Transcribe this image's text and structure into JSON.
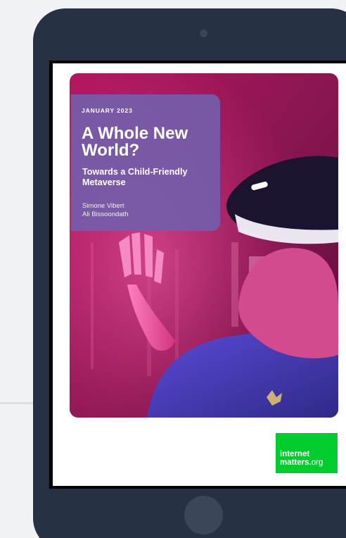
{
  "report": {
    "date": "JANUARY 2023",
    "title": "A Whole New World?",
    "subtitle": "Towards a Child-Friendly Metaverse",
    "authors": [
      "Simone Vibert",
      "Ali Bissoondath"
    ]
  },
  "logo": {
    "line1": "internet",
    "line2_main": "matters",
    "line2_dot": ".",
    "line2_suffix": "org"
  },
  "colors": {
    "background": "#f1f2f4",
    "tablet_frame": "#263143",
    "title_card": "#745caa",
    "cover_magenta": "#c21c6e",
    "logo_green": "#00cc2e"
  },
  "icons": {
    "tablet_camera": "camera-icon",
    "tablet_home": "home-button-icon"
  }
}
